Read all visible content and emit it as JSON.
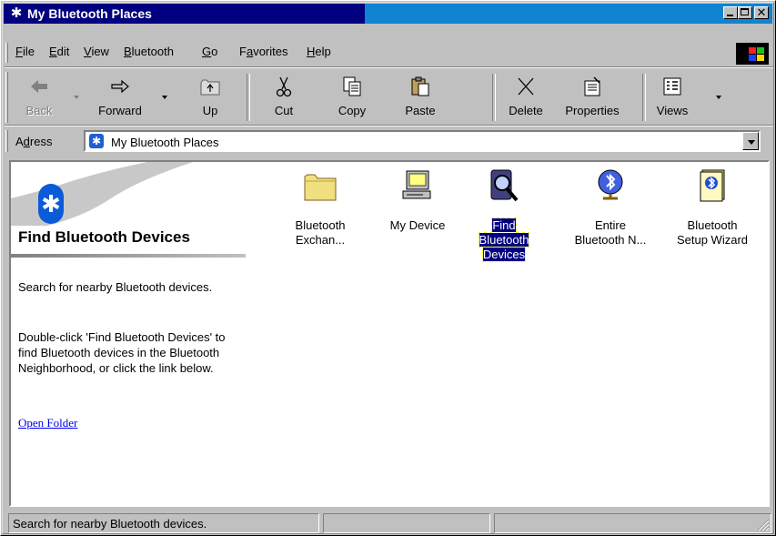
{
  "window": {
    "title": "My Bluetooth Places",
    "controls": [
      "minimize",
      "maximize",
      "close"
    ]
  },
  "menu": {
    "items": [
      {
        "label": "File",
        "key": "F",
        "rest": "ile"
      },
      {
        "label": "Edit",
        "key": "E",
        "rest": "dit"
      },
      {
        "label": "View",
        "key": "V",
        "rest": "iew"
      },
      {
        "label": "Bluetooth",
        "key": "B",
        "rest": "luetooth"
      },
      {
        "label": "Go",
        "key": "G",
        "rest": "o"
      },
      {
        "label": "Favorites",
        "key": "a",
        "pre": "F",
        "rest": "vorites"
      },
      {
        "label": "Help",
        "key": "H",
        "rest": "elp"
      }
    ]
  },
  "toolbar": {
    "back": "Back",
    "forward": "Forward",
    "up": "Up",
    "cut": "Cut",
    "copy": "Copy",
    "paste": "Paste",
    "delete": "Delete",
    "properties": "Properties",
    "views": "Views"
  },
  "address": {
    "label_key": "d",
    "label_pre": "A",
    "label_rest": "ress",
    "value": "My Bluetooth Places"
  },
  "panel": {
    "title": "Find Bluetooth Devices",
    "description": "Search for nearby Bluetooth devices.",
    "details": "Double-click 'Find Bluetooth Devices' to find Bluetooth devices in the Bluetooth Neighborhood, or click the link below.",
    "link": "Open Folder"
  },
  "items": [
    {
      "line1": "Bluetooth",
      "line2": "Exchan...",
      "icon": "folder-icon",
      "selected": false
    },
    {
      "line1": "My Device",
      "line2": "",
      "icon": "computer-icon",
      "selected": false
    },
    {
      "line1": "Find Bluetooth",
      "line2": "Devices",
      "icon": "magnifier-icon",
      "selected": true
    },
    {
      "line1": "Entire",
      "line2": "Bluetooth N...",
      "icon": "bluetooth-globe-icon",
      "selected": false
    },
    {
      "line1": "Bluetooth",
      "line2": "Setup Wizard",
      "icon": "bluetooth-book-icon",
      "selected": false
    }
  ],
  "status": {
    "text": "Search for nearby Bluetooth devices."
  },
  "colors": {
    "title_active": "#000080",
    "selection": "#000080",
    "face": "#c0c0c0",
    "link": "#0000ee"
  }
}
